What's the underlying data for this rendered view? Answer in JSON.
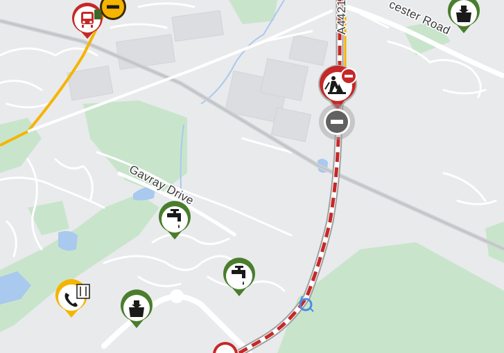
{
  "map": {
    "road_labels": {
      "gavray_drive": "Gavray Drive",
      "a4421": "A4421",
      "bicester_road": "cester Road"
    },
    "markers": [
      {
        "id": "bus-stop",
        "icon": "bus-icon",
        "type": "transport",
        "color": "#c62828"
      },
      {
        "id": "road-closed-top",
        "icon": "no-entry-icon",
        "type": "closure",
        "color": "#f5b400"
      },
      {
        "id": "roadworks",
        "icon": "roadworks-icon",
        "type": "roadworks",
        "color": "#c62828"
      },
      {
        "id": "road-closed",
        "icon": "no-entry-icon",
        "type": "closure",
        "color": "#616161"
      },
      {
        "id": "water-tap-1",
        "icon": "water-tap-icon",
        "type": "utility",
        "color": "#4a7d2c"
      },
      {
        "id": "water-tap-2",
        "icon": "water-tap-icon",
        "type": "utility",
        "color": "#4a7d2c"
      },
      {
        "id": "waste-bin-1",
        "icon": "waste-bin-icon",
        "type": "utility",
        "color": "#4a7d2c"
      },
      {
        "id": "waste-bin-2",
        "icon": "waste-bin-icon",
        "type": "utility",
        "color": "#4a7d2c"
      },
      {
        "id": "telephone",
        "icon": "telephone-icon",
        "type": "utility",
        "color": "#f5b400"
      }
    ],
    "colors": {
      "background": "#e9eaec",
      "park": "#c8e5cc",
      "water": "#a9c9ee",
      "road_minor": "#ffffff",
      "road_major": "#f5b400",
      "closure": "#c62828"
    }
  }
}
